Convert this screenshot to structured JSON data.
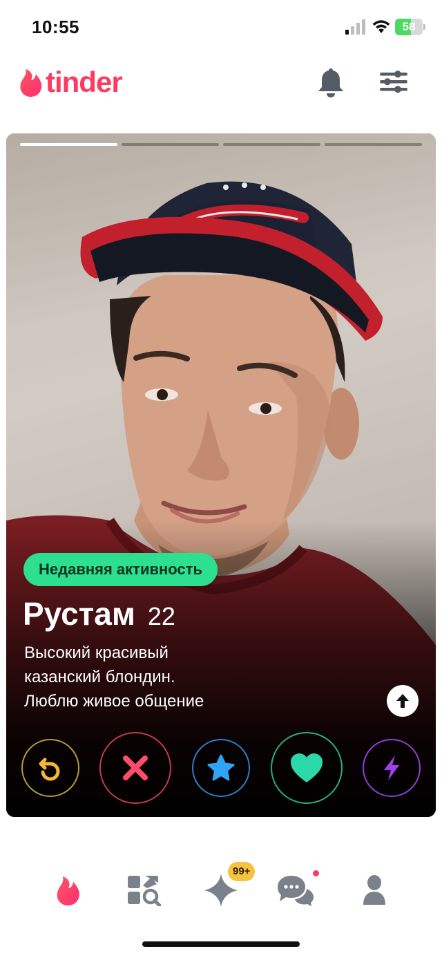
{
  "status_bar": {
    "time": "10:55",
    "battery": "58",
    "battery_level": 0.58,
    "icons": [
      "cellular-signal-icon",
      "wifi-icon",
      "battery-icon"
    ]
  },
  "header": {
    "logo_text": "tinder",
    "brand_color": "#fd3a5f",
    "icons": [
      "flame-logo-icon",
      "bell-icon",
      "filter-sliders-icon"
    ]
  },
  "card": {
    "photo_count": 4,
    "active_photo": 1,
    "activity_badge": "Недавняя активность",
    "name": "Рустам",
    "age": "22",
    "bio_lines": [
      "Высокий красивый",
      "казанский блондин.",
      "Люблю живое общение"
    ],
    "info_icon": "arrow-up-icon",
    "actions": [
      {
        "icon": "rewind-icon",
        "color": "#f5b82e"
      },
      {
        "icon": "nope-x-icon",
        "color": "#fd4d6b"
      },
      {
        "icon": "super-like-star-icon",
        "color": "#2fa4f5"
      },
      {
        "icon": "like-heart-icon",
        "color": "#2bd9a8"
      },
      {
        "icon": "boost-lightning-icon",
        "color": "#a23ef0"
      }
    ]
  },
  "bottom_nav": {
    "items": [
      "home-flame-icon",
      "explore-icon",
      "gold-sparkle-icon",
      "chat-icon",
      "profile-icon"
    ],
    "gold_badge": "99+",
    "badge_color": "#f6c242"
  }
}
